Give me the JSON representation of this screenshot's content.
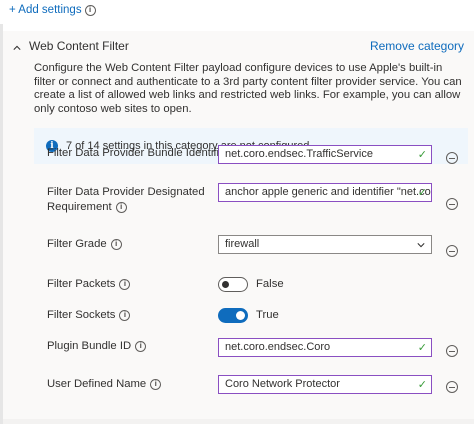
{
  "top": {
    "add_settings": "+ Add settings"
  },
  "section": {
    "title": "Web Content Filter",
    "remove_label": "Remove category",
    "description": "Configure the Web Content Filter payload configure devices to use Apple's built-in filter or connect and authenticate to a 3rd party content filter provider service. You can create a list of allowed web links and restricted web links. For example, you can allow only contoso web sites to open.",
    "banner": "7 of 14 settings in this category are not configured"
  },
  "settings": {
    "bundle_identifier": {
      "label": "Filter Data Provider Bundle Identifier",
      "value": "net.coro.endsec.TrafficService"
    },
    "designated_requirement": {
      "label": "Filter Data Provider Designated Requirement",
      "value": "anchor apple generic and identifier \"net.coro.en..."
    },
    "filter_grade": {
      "label": "Filter Grade",
      "value": "firewall"
    },
    "filter_packets": {
      "label": "Filter Packets",
      "state": "False"
    },
    "filter_sockets": {
      "label": "Filter Sockets",
      "state": "True"
    },
    "plugin_bundle_id": {
      "label": "Plugin Bundle ID",
      "value": "net.coro.endsec.Coro"
    },
    "user_defined_name": {
      "label": "User Defined Name",
      "value": "Coro Network Protector"
    }
  },
  "colors": {
    "accent": "#0f6cbd",
    "field_border": "#8a4fc2",
    "check": "#3a9c3a",
    "banner_bg": "#eff6fc"
  },
  "icons": [
    "info-icon",
    "chevron-up-icon",
    "check-icon",
    "chevron-down-icon",
    "remove-circle-icon"
  ]
}
